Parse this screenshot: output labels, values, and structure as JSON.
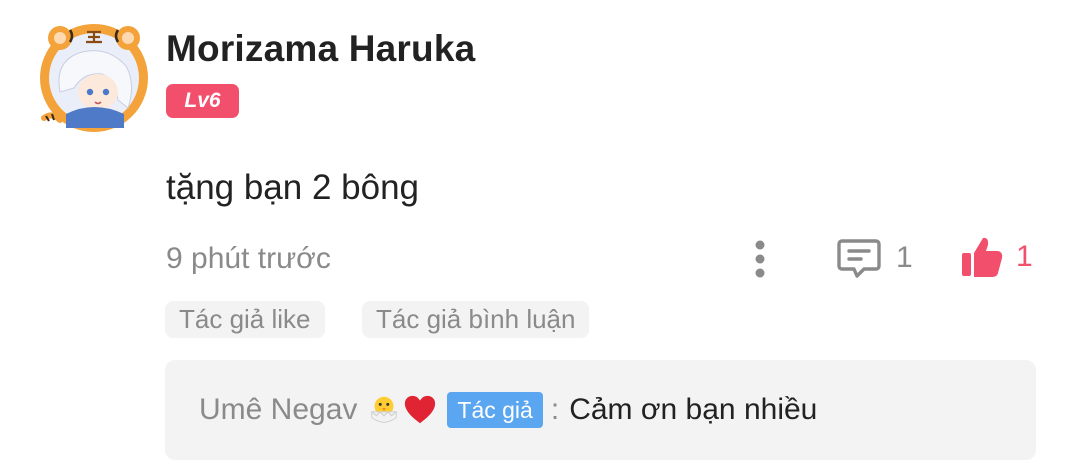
{
  "comment": {
    "author": "Morizama Haruka",
    "level": "Lv6",
    "text": "tặng bạn 2 bông",
    "time": "9 phút trước",
    "reply_count": "1",
    "like_count": "1",
    "tags": [
      "Tác giả like",
      "Tác giả bình luận"
    ]
  },
  "reply": {
    "author": "Umê Negav",
    "author_badge": "Tác giả",
    "separator": ":",
    "text": "Cảm ơn bạn nhiều"
  },
  "icons": {
    "more": "more-vertical-icon",
    "reply": "comment-icon",
    "like": "thumbs-up-icon",
    "emoji_1": "hatching-chick-icon",
    "emoji_2": "red-heart-icon"
  },
  "colors": {
    "accent": "#f24f6d",
    "author_badge": "#5aa6f0",
    "muted_text": "#8a8a8a",
    "text": "#222222",
    "tag_bg": "#f3f3f3"
  }
}
